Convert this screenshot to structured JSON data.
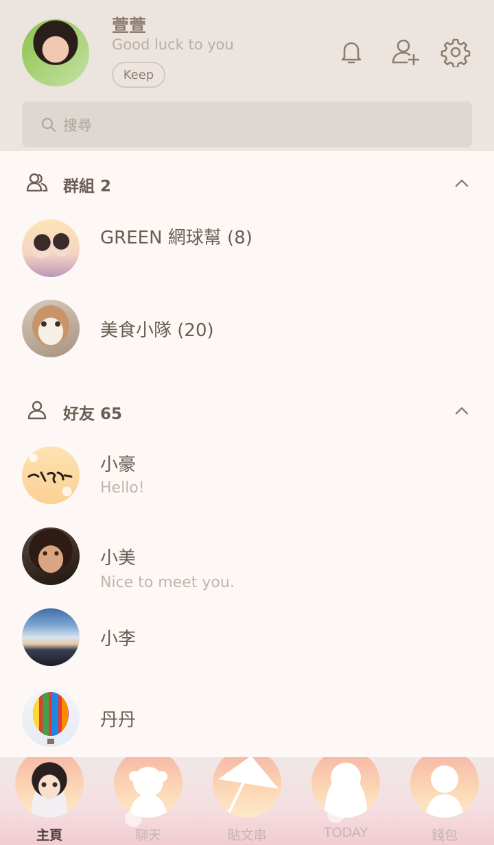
{
  "profile": {
    "name": "萱萱",
    "status": "Good luck to you",
    "keep_label": "Keep"
  },
  "search": {
    "placeholder": "搜尋"
  },
  "groups": {
    "header": "群組 2",
    "items": [
      {
        "name": "GREEN 網球幫 (8)"
      },
      {
        "name": "美食小隊 (20)"
      }
    ]
  },
  "friends": {
    "header": "好友 65",
    "items": [
      {
        "name": "小豪",
        "status": "Hello!"
      },
      {
        "name": "小美",
        "status": "Nice to meet you."
      },
      {
        "name": "小李",
        "status": ""
      },
      {
        "name": "丹丹",
        "status": ""
      }
    ]
  },
  "tabs": [
    {
      "label": "主頁",
      "active": true
    },
    {
      "label": "聊天"
    },
    {
      "label": "貼文串"
    },
    {
      "label": "TODAY"
    },
    {
      "label": "錢包"
    }
  ],
  "colors": {
    "header_bg": "#ece4de",
    "body_bg": "#fdf8f6",
    "text": "#6a5c52",
    "muted": "#c0b5ad",
    "tab_active": "#4a3e38"
  }
}
